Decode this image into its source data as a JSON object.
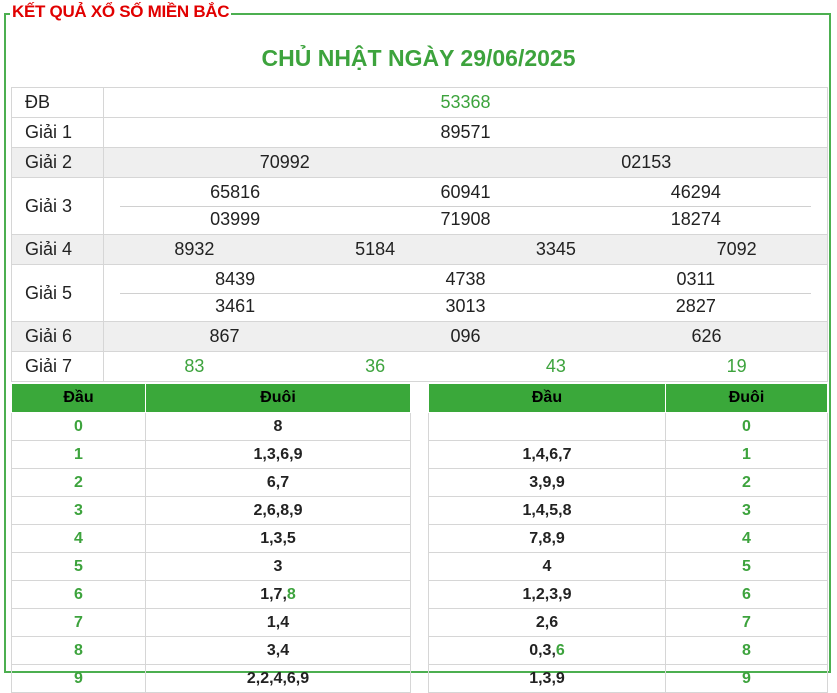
{
  "header": {
    "legend": "KẾT QUẢ XỔ SỐ MIỀN BẮC",
    "date_title": "CHỦ NHẬT NGÀY 29/06/2025"
  },
  "prizes": {
    "db": {
      "label": "ĐB",
      "values": [
        "53368"
      ]
    },
    "g1": {
      "label": "Giải 1",
      "values": [
        "89571"
      ]
    },
    "g2": {
      "label": "Giải 2",
      "values": [
        "70992",
        "02153"
      ]
    },
    "g3": {
      "label": "Giải 3",
      "values": [
        "65816",
        "60941",
        "46294",
        "03999",
        "71908",
        "18274"
      ]
    },
    "g4": {
      "label": "Giải 4",
      "values": [
        "8932",
        "5184",
        "3345",
        "7092"
      ]
    },
    "g5": {
      "label": "Giải 5",
      "values": [
        "8439",
        "4738",
        "0311",
        "3461",
        "3013",
        "2827"
      ]
    },
    "g6": {
      "label": "Giải 6",
      "values": [
        "867",
        "096",
        "626"
      ]
    },
    "g7": {
      "label": "Giải 7",
      "values": [
        "83",
        "36",
        "43",
        "19"
      ]
    }
  },
  "loto_head": {
    "h1": "Đầu",
    "h2": "Đuôi",
    "rows": [
      {
        "k": "0",
        "v": "8"
      },
      {
        "k": "1",
        "v": "1,3,6,9"
      },
      {
        "k": "2",
        "v": "6,7"
      },
      {
        "k": "3",
        "v": "2,6,8,9"
      },
      {
        "k": "4",
        "v": "1,3,5"
      },
      {
        "k": "5",
        "v": "3"
      },
      {
        "k": "6",
        "v": "1,7,",
        "hl": "8"
      },
      {
        "k": "7",
        "v": "1,4"
      },
      {
        "k": "8",
        "v": "3,4"
      },
      {
        "k": "9",
        "v": "2,2,4,6,9"
      }
    ]
  },
  "loto_tail": {
    "h1": "Đầu",
    "h2": "Đuôi",
    "rows": [
      {
        "v": "",
        "k": "0"
      },
      {
        "v": "1,4,6,7",
        "k": "1"
      },
      {
        "v": "3,9,9",
        "k": "2"
      },
      {
        "v": "1,4,5,8",
        "k": "3"
      },
      {
        "v": "7,8,9",
        "k": "4"
      },
      {
        "v": "4",
        "k": "5"
      },
      {
        "v": "1,2,3,9",
        "k": "6"
      },
      {
        "v": "2,6",
        "k": "7"
      },
      {
        "v": "0,3,",
        "hl": "6",
        "k": "8"
      },
      {
        "v": "1,3,9",
        "k": "9"
      }
    ]
  },
  "colors": {
    "accent": "#3da33d",
    "title_red": "#e10000",
    "header_green": "#3aa83a"
  }
}
